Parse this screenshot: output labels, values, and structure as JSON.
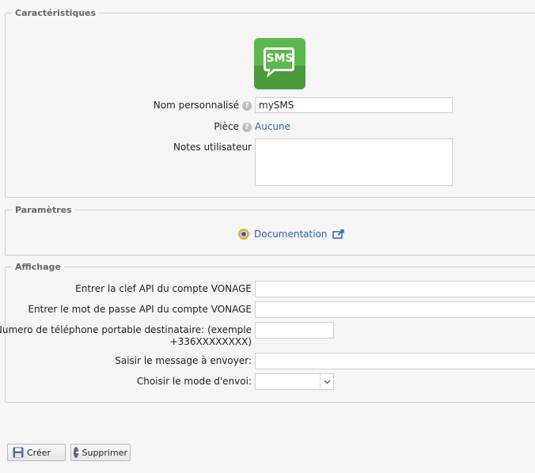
{
  "characteristics": {
    "legend": "Caractéristiques",
    "icon_text": "SMS",
    "name_label": "Nom personnalisé",
    "name_value": "mySMS",
    "room_label": "Pièce",
    "room_value": "Aucune",
    "notes_label": "Notes utilisateur",
    "notes_value": ""
  },
  "parameters": {
    "legend": "Paramètres",
    "doc_label": "Documentation"
  },
  "display": {
    "legend": "Affichage",
    "api_key_label": "Entrer la clef API du compte VONAGE",
    "api_key_value": "",
    "api_pass_label": "Entrer le mot de passe API du compte VONAGE",
    "api_pass_value": "",
    "phone_label_1": "Numero de téléphone portable destinataire: (exemple",
    "phone_label_2": "+336XXXXXXXX)",
    "phone_value": "",
    "message_label": "Saisir le message à envoyer:",
    "message_value": "",
    "mode_label": "Choisir le mode d'envoi:",
    "mode_value": ""
  },
  "buttons": {
    "create_label": "Créer",
    "delete_label": "Supprimer"
  },
  "colors": {
    "sms_icon_green": "#5cb84c",
    "link_blue": "#2a67b1"
  }
}
